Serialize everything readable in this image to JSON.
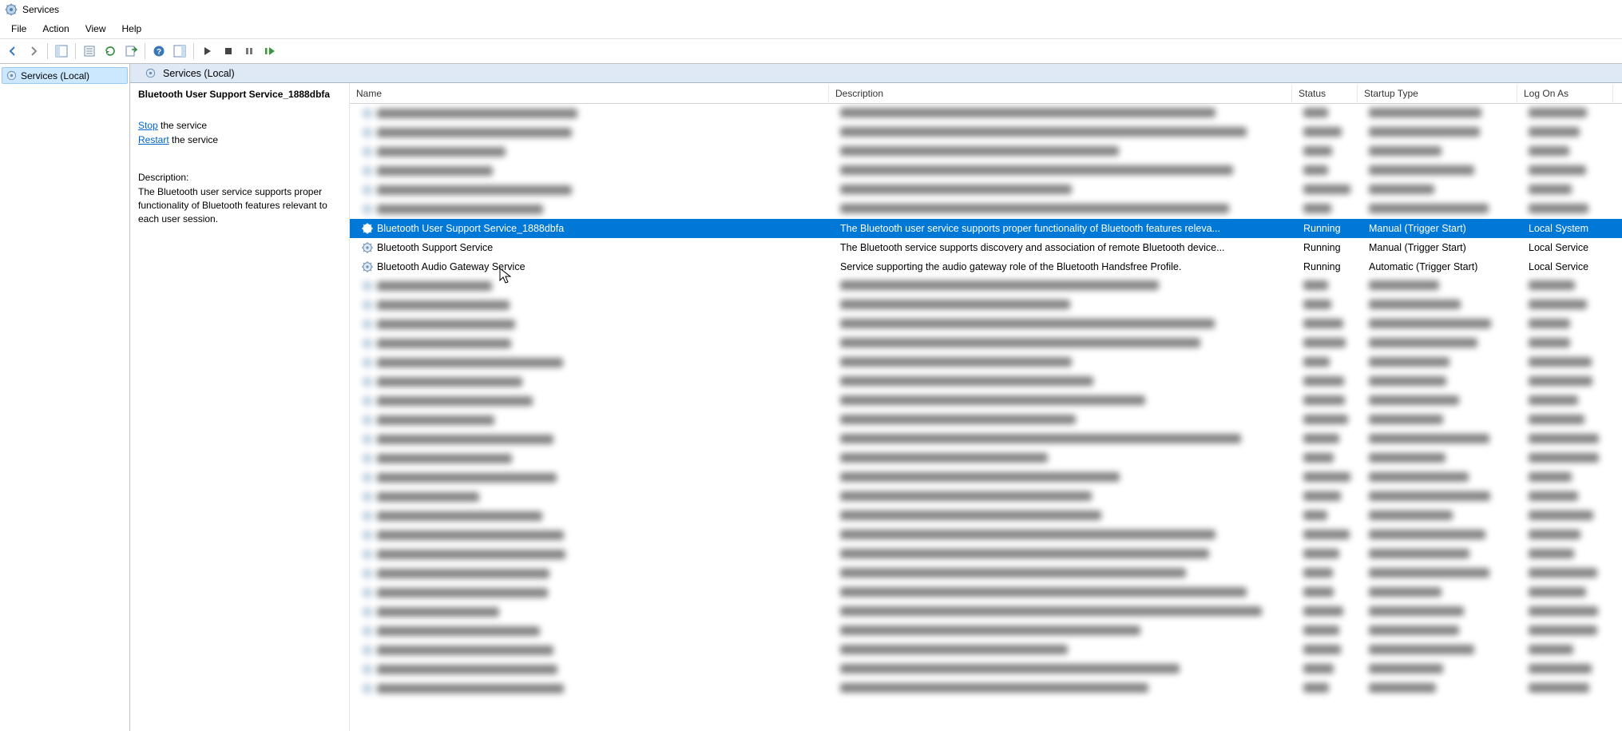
{
  "window": {
    "title": "Services"
  },
  "menu": {
    "file": "File",
    "action": "Action",
    "view": "View",
    "help": "Help"
  },
  "tree": {
    "root": "Services (Local)"
  },
  "details": {
    "selected_name": "Bluetooth User Support Service_1888dbfa",
    "stop": "Stop",
    "the_service_1": " the service",
    "restart": "Restart",
    "the_service_2": " the service",
    "desc_label": "Description:",
    "desc_text": "The Bluetooth user service supports proper functionality of Bluetooth features relevant to each user session."
  },
  "header": {
    "title": "Services (Local)"
  },
  "columns": {
    "name": "Name",
    "description": "Description",
    "status": "Status",
    "startup": "Startup Type",
    "logon": "Log On As"
  },
  "rows": [
    {
      "name": "Bluetooth User Support Service_1888dbfa",
      "description": "The Bluetooth user service supports proper functionality of Bluetooth features releva...",
      "status": "Running",
      "startup": "Manual (Trigger Start)",
      "logon": "Local System",
      "selected": true
    },
    {
      "name": "Bluetooth Support Service",
      "description": "The Bluetooth service supports discovery and association of remote Bluetooth device...",
      "status": "Running",
      "startup": "Manual (Trigger Start)",
      "logon": "Local Service",
      "selected": false
    },
    {
      "name": "Bluetooth Audio Gateway Service",
      "description": "Service supporting the audio gateway role of the Bluetooth Handsfree Profile.",
      "status": "Running",
      "startup": "Automatic (Trigger Start)",
      "logon": "Local Service",
      "selected": false
    }
  ]
}
